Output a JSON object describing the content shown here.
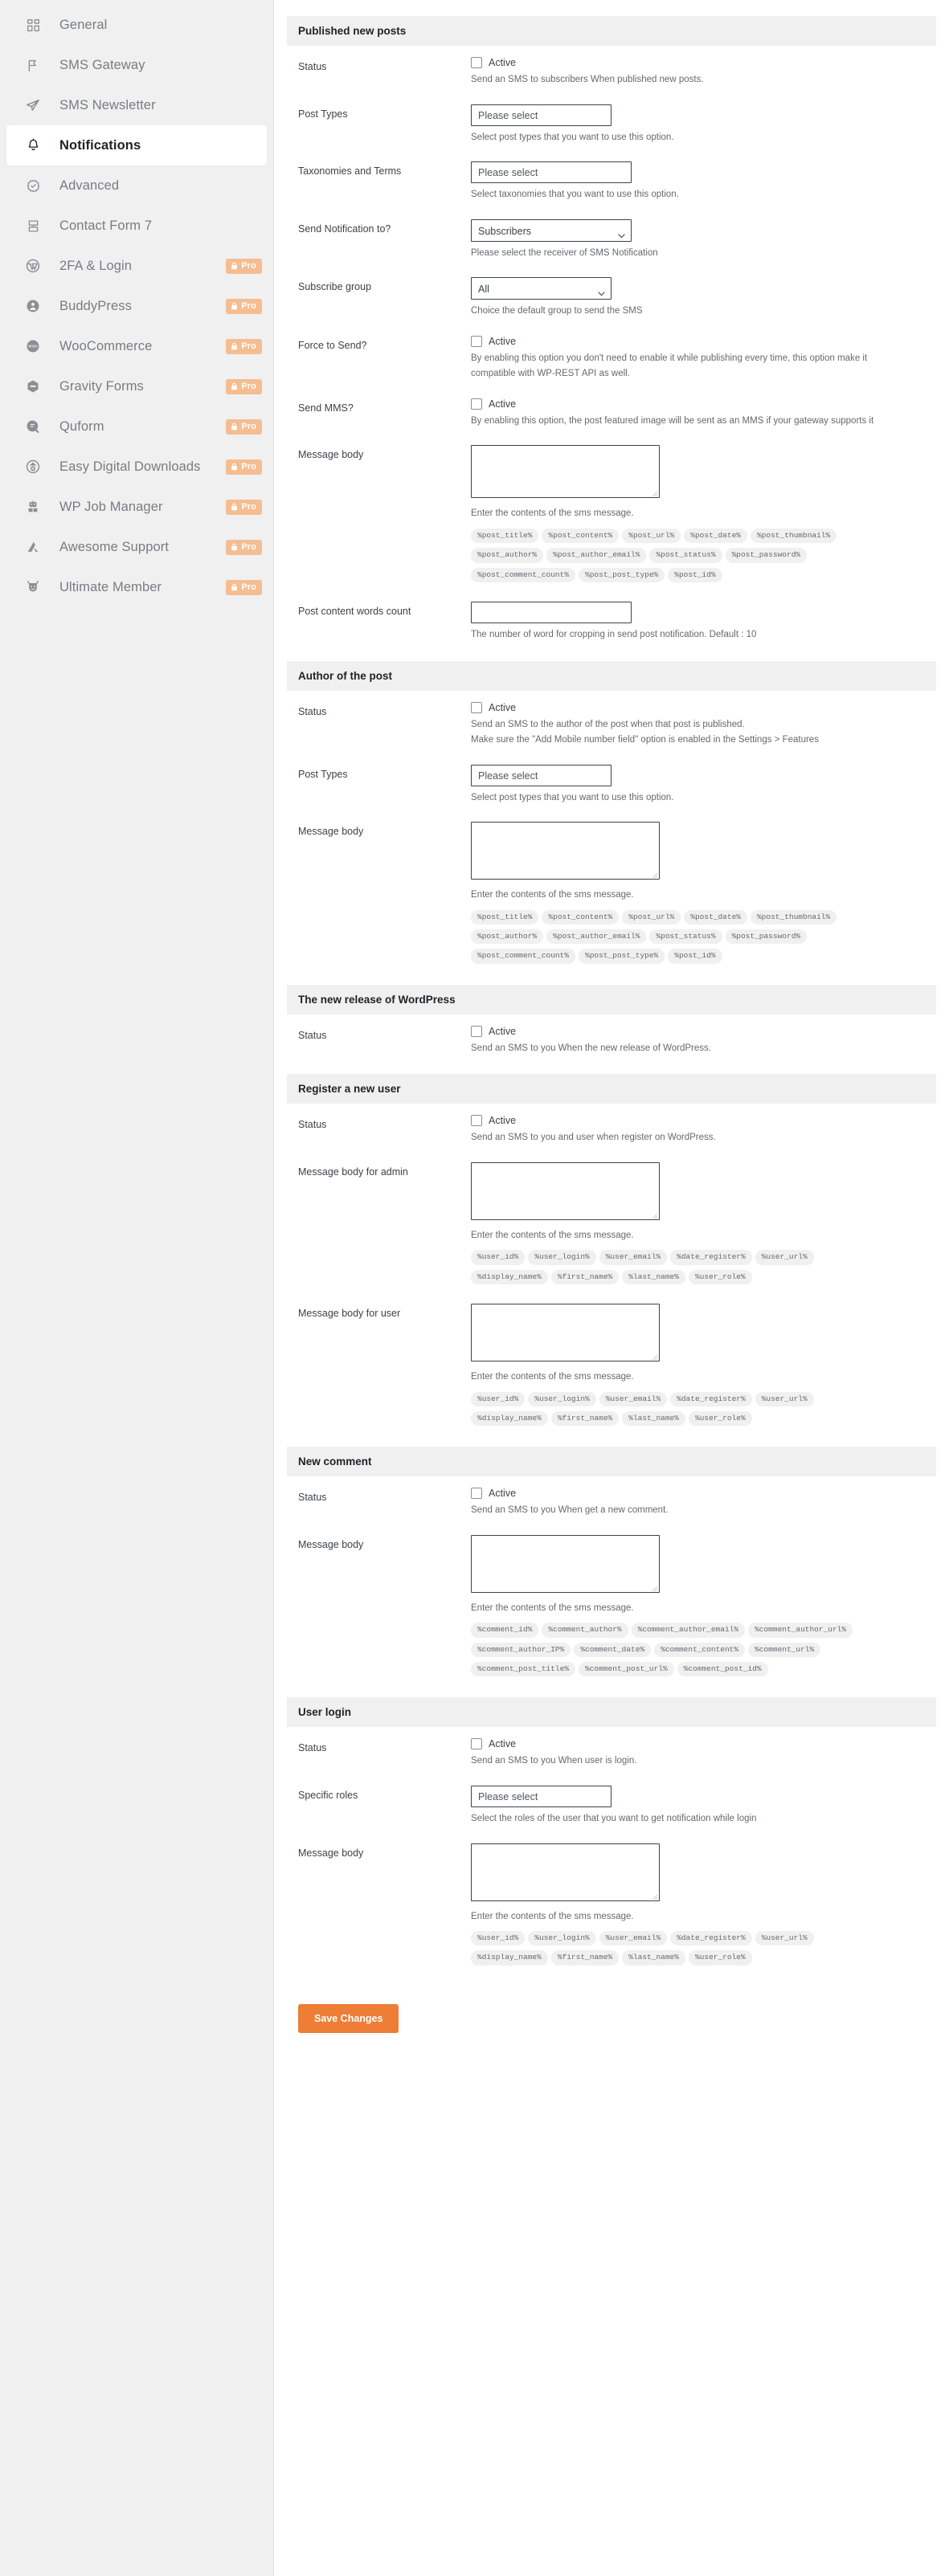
{
  "sidebar": {
    "items": [
      {
        "label": "General",
        "icon": "grid-icon",
        "active": false,
        "pro": false
      },
      {
        "label": "SMS Gateway",
        "icon": "flag-icon",
        "active": false,
        "pro": false
      },
      {
        "label": "SMS Newsletter",
        "icon": "send-icon",
        "active": false,
        "pro": false
      },
      {
        "label": "Notifications",
        "icon": "bell-icon",
        "active": true,
        "pro": false
      },
      {
        "label": "Advanced",
        "icon": "badge-check-icon",
        "active": false,
        "pro": false
      },
      {
        "label": "Contact Form 7",
        "icon": "form-icon",
        "active": false,
        "pro": false
      },
      {
        "label": "2FA & Login",
        "icon": "wordpress-icon",
        "active": false,
        "pro": true
      },
      {
        "label": "BuddyPress",
        "icon": "buddypress-icon",
        "active": false,
        "pro": true
      },
      {
        "label": "WooCommerce",
        "icon": "woocommerce-icon",
        "active": false,
        "pro": true
      },
      {
        "label": "Gravity Forms",
        "icon": "gravityforms-icon",
        "active": false,
        "pro": true
      },
      {
        "label": "Quform",
        "icon": "quform-icon",
        "active": false,
        "pro": true
      },
      {
        "label": "Easy Digital Downloads",
        "icon": "edd-icon",
        "active": false,
        "pro": true
      },
      {
        "label": "WP Job Manager",
        "icon": "wpjob-icon",
        "active": false,
        "pro": true
      },
      {
        "label": "Awesome Support",
        "icon": "awesome-icon",
        "active": false,
        "pro": true
      },
      {
        "label": "Ultimate Member",
        "icon": "ultimate-icon",
        "active": false,
        "pro": true
      }
    ],
    "pro_label": "Pro"
  },
  "common": {
    "active_label": "Active",
    "please_select": "Please select",
    "sms_contents_hint": "Enter the contents of the sms message."
  },
  "colors": {
    "accent": "#ee7d35",
    "pro_badge": "#f5bd90",
    "section_head_bg": "#f0f0f1",
    "tag_bg": "#f0f0f1"
  },
  "tag_sets": {
    "post": [
      "%post_title%",
      "%post_content%",
      "%post_url%",
      "%post_date%",
      "%post_thumbnail%",
      "%post_author%",
      "%post_author_email%",
      "%post_status%",
      "%post_password%",
      "%post_comment_count%",
      "%post_post_type%",
      "%post_id%"
    ],
    "user": [
      "%user_id%",
      "%user_login%",
      "%user_email%",
      "%date_register%",
      "%user_url%",
      "%display_name%",
      "%first_name%",
      "%last_name%",
      "%user_role%"
    ],
    "comment": [
      "%comment_id%",
      "%comment_author%",
      "%comment_author_email%",
      "%comment_author_url%",
      "%comment_author_IP%",
      "%comment_date%",
      "%comment_content%",
      "%comment_url%",
      "%comment_post_title%",
      "%comment_post_url%",
      "%comment_post_id%"
    ]
  },
  "sections": {
    "published_new_posts": {
      "title": "Published new posts",
      "status": {
        "label": "Status",
        "checkbox_label": "Active",
        "checked": false,
        "desc": "Send an SMS to subscribers When published new posts."
      },
      "post_types": {
        "label": "Post Types",
        "value": "Please select",
        "desc": "Select post types that you want to use this option."
      },
      "taxonomies": {
        "label": "Taxonomies and Terms",
        "value": "Please select",
        "desc": "Select taxonomies that you want to use this option."
      },
      "send_notification_to": {
        "label": "Send Notification to?",
        "value": "Subscribers",
        "desc": "Please select the receiver of SMS Notification"
      },
      "subscribe_group": {
        "label": "Subscribe group",
        "value": "All",
        "desc": "Choice the default group to send the SMS"
      },
      "force_to_send": {
        "label": "Force to Send?",
        "checkbox_label": "Active",
        "checked": false,
        "desc": "By enabling this option you don't need to enable it while publishing every time, this option make it compatible with WP-REST API as well."
      },
      "send_mms": {
        "label": "Send MMS?",
        "checkbox_label": "Active",
        "checked": false,
        "desc": "By enabling this option, the post featured image will be sent as an MMS if your gateway supports it"
      },
      "message_body": {
        "label": "Message body",
        "value": "",
        "desc": "Enter the contents of the sms message."
      },
      "post_content_words_count": {
        "label": "Post content words count",
        "value": "",
        "desc": "The number of word for cropping in send post notification. Default : 10"
      }
    },
    "author_of_the_post": {
      "title": "Author of the post",
      "status": {
        "label": "Status",
        "checkbox_label": "Active",
        "checked": false,
        "desc_line1": "Send an SMS to the author of the post when that post is published.",
        "desc_line2": "Make sure the \"Add Mobile number field\" option is enabled in the Settings > Features"
      },
      "post_types": {
        "label": "Post Types",
        "value": "Please select",
        "desc": "Select post types that you want to use this option."
      },
      "message_body": {
        "label": "Message body",
        "value": "",
        "desc": "Enter the contents of the sms message."
      }
    },
    "new_release_wordpress": {
      "title": "The new release of WordPress",
      "status": {
        "label": "Status",
        "checkbox_label": "Active",
        "checked": false,
        "desc": "Send an SMS to you When the new release of WordPress."
      }
    },
    "register_new_user": {
      "title": "Register a new user",
      "status": {
        "label": "Status",
        "checkbox_label": "Active",
        "checked": false,
        "desc": "Send an SMS to you and user when register on WordPress."
      },
      "message_body_admin": {
        "label": "Message body for admin",
        "value": "",
        "desc": "Enter the contents of the sms message."
      },
      "message_body_user": {
        "label": "Message body for user",
        "value": "",
        "desc": "Enter the contents of the sms message."
      }
    },
    "new_comment": {
      "title": "New comment",
      "status": {
        "label": "Status",
        "checkbox_label": "Active",
        "checked": false,
        "desc": "Send an SMS to you When get a new comment."
      },
      "message_body": {
        "label": "Message body",
        "value": "",
        "desc": "Enter the contents of the sms message."
      }
    },
    "user_login": {
      "title": "User login",
      "status": {
        "label": "Status",
        "checkbox_label": "Active",
        "checked": false,
        "desc": "Send an SMS to you When user is login."
      },
      "specific_roles": {
        "label": "Specific roles",
        "value": "Please select",
        "desc": "Select the roles of the user that you want to get notification while login"
      },
      "message_body": {
        "label": "Message body",
        "value": "",
        "desc": "Enter the contents of the sms message."
      }
    }
  },
  "footer": {
    "save_label": "Save Changes"
  }
}
